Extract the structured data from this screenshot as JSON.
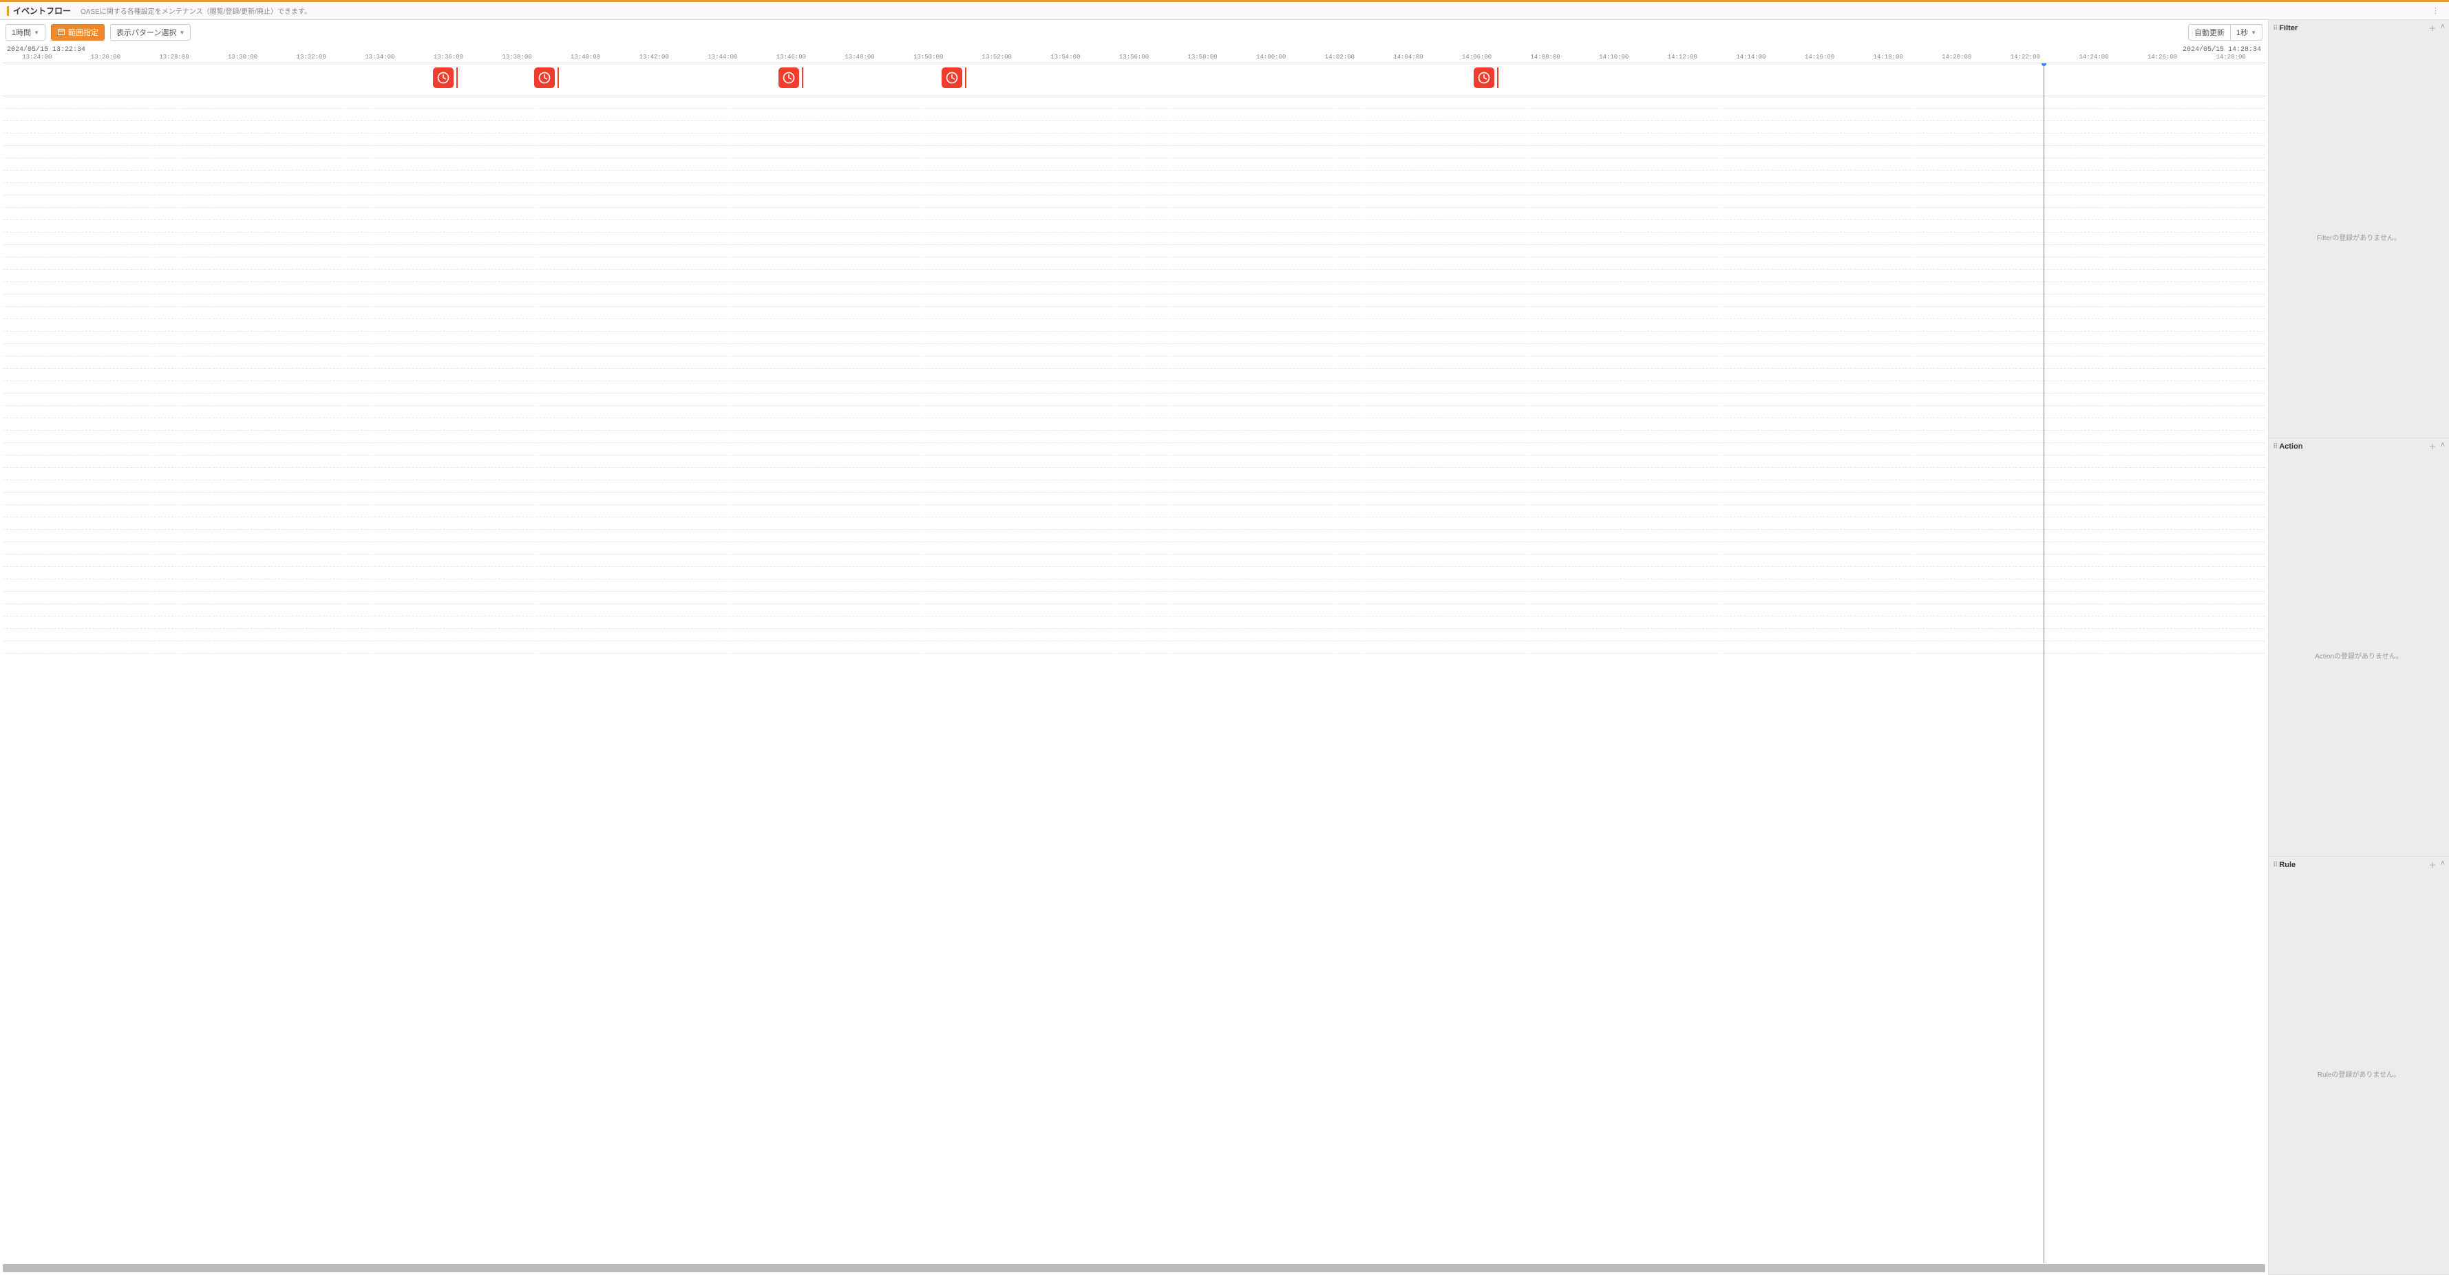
{
  "header": {
    "title": "イベントフロー",
    "description": "OASEに関する各種設定をメンテナンス（閲覧/登録/更新/廃止）できます。"
  },
  "toolbar": {
    "range_label": "1時間",
    "range_button": "範囲指定",
    "pattern_label": "表示パターン選択",
    "auto_refresh": "自動更新",
    "interval": "1秒"
  },
  "time_bounds": {
    "start": "2024/05/15 13:22:34",
    "end": "2024/05/15 14:28:34"
  },
  "ticks": [
    "13:24:00",
    "13:26:00",
    "13:28:00",
    "13:30:00",
    "13:32:00",
    "13:34:00",
    "13:36:00",
    "13:38:00",
    "13:40:00",
    "13:42:00",
    "13:44:00",
    "13:46:00",
    "13:48:00",
    "13:50:00",
    "13:52:00",
    "13:54:00",
    "13:56:00",
    "13:58:00",
    "14:00:00",
    "14:02:00",
    "14:04:00",
    "14:06:00",
    "14:08:00",
    "14:10:00",
    "14:12:00",
    "14:14:00",
    "14:16:00",
    "14:18:00",
    "14:20:00",
    "14:22:00",
    "14:24:00",
    "14:26:00",
    "14:28:00"
  ],
  "events": [
    {
      "pos_percent": 19.0
    },
    {
      "pos_percent": 23.5
    },
    {
      "pos_percent": 34.3
    },
    {
      "pos_percent": 41.5
    },
    {
      "pos_percent": 65.0
    }
  ],
  "now_line_percent": 90.2,
  "panels": {
    "filter": {
      "title": "Filter",
      "empty": "Filterの登録がありません。"
    },
    "action": {
      "title": "Action",
      "empty": "Actionの登録がありません。"
    },
    "rule": {
      "title": "Rule",
      "empty": "Ruleの登録がありません。"
    }
  },
  "icons": {
    "calendar": "calendar-icon",
    "clock": "clock-icon"
  }
}
